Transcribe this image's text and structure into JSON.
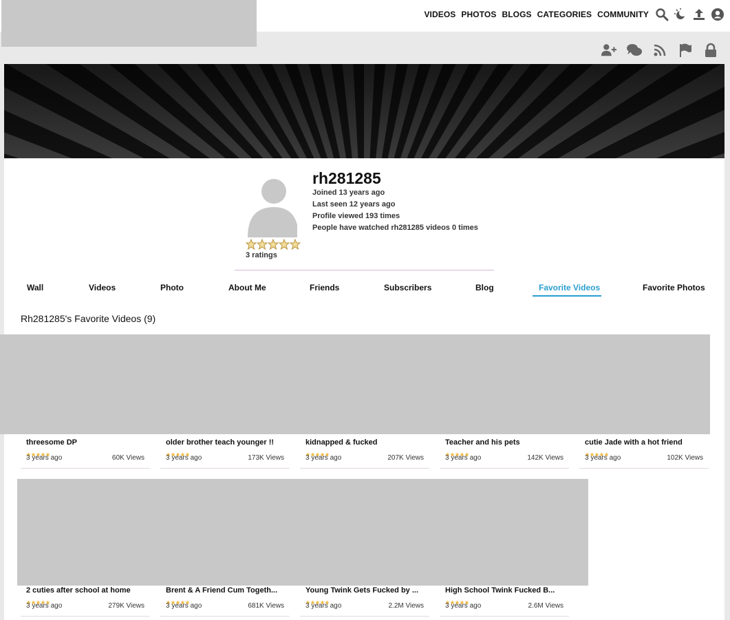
{
  "nav": {
    "items": [
      "VIDEOS",
      "PHOTOS",
      "BLOGS",
      "CATEGORIES",
      "COMMUNITY"
    ],
    "icons": [
      "search-icon",
      "theme-toggle-icon",
      "upload-icon",
      "account-icon"
    ]
  },
  "actions": {
    "icons": [
      "add-friend-icon",
      "message-icon",
      "rss-icon",
      "flag-icon",
      "lock-icon"
    ]
  },
  "profile": {
    "username": "rh281285",
    "joined": "Joined 13 years ago",
    "last_seen": "Last seen 12 years ago",
    "profile_views": "Profile viewed 193 times",
    "watched": "People have watched rh281285 videos 0 times",
    "ratings": "3 ratings",
    "star_rating": 5
  },
  "tabs": [
    {
      "label": "Wall"
    },
    {
      "label": "Videos"
    },
    {
      "label": "Photo"
    },
    {
      "label": "About Me"
    },
    {
      "label": "Friends"
    },
    {
      "label": "Subscribers"
    },
    {
      "label": "Blog"
    },
    {
      "label": "Favorite Videos",
      "active": true
    },
    {
      "label": "Favorite Photos"
    }
  ],
  "section_title": "Rh281285's Favorite Videos (9)",
  "videos": [
    {
      "title": "threesome DP",
      "ago": "3 years ago",
      "views": "60K Views"
    },
    {
      "title": "older brother teach younger !!",
      "ago": "3 years ago",
      "views": "173K Views"
    },
    {
      "title": "kidnapped & fucked",
      "ago": "3 years ago",
      "views": "207K Views"
    },
    {
      "title": "Teacher and his pets",
      "ago": "3 years ago",
      "views": "142K Views"
    },
    {
      "title": "cutie Jade with a hot friend",
      "ago": "3 years ago",
      "views": "102K Views"
    },
    {
      "title": "2 cuties after school at home",
      "ago": "3 years ago",
      "views": "279K Views"
    },
    {
      "title": "Brent & A Friend Cum Togeth...",
      "ago": "3 years ago",
      "views": "681K Views"
    },
    {
      "title": "Young Twink Gets Fucked by ...",
      "ago": "3 years ago",
      "views": "2.2M Views"
    },
    {
      "title": "High School Twink Fucked B...",
      "ago": "3 years ago",
      "views": "2.6M Views"
    }
  ],
  "colors": {
    "accent": "#2a9ed0",
    "star": "#f0b840",
    "redacted": "#c8c8c8"
  }
}
